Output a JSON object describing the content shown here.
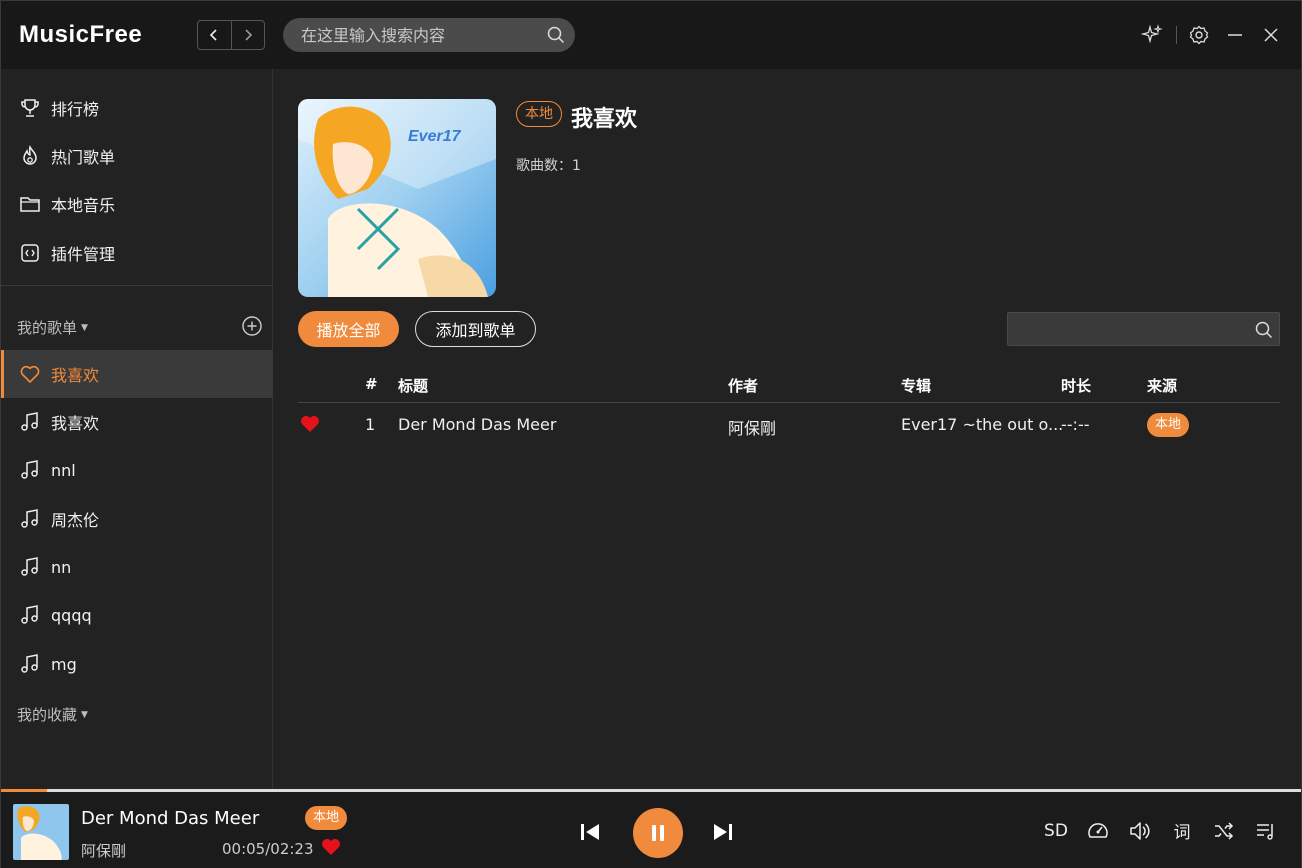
{
  "app": {
    "name": "MusicFree"
  },
  "search": {
    "placeholder": "在这里输入搜索内容"
  },
  "sidebar": {
    "nav": [
      {
        "label": "排行榜",
        "icon": "trophy-icon"
      },
      {
        "label": "热门歌单",
        "icon": "flame-icon"
      },
      {
        "label": "本地音乐",
        "icon": "folder-icon"
      },
      {
        "label": "插件管理",
        "icon": "plugin-icon"
      }
    ],
    "my_sheets_label": "我的歌单",
    "my_sheets": [
      {
        "label": "我喜欢",
        "icon": "heart-icon",
        "active": true
      },
      {
        "label": "我喜欢",
        "icon": "music-note-icon"
      },
      {
        "label": "nnl",
        "icon": "music-note-icon"
      },
      {
        "label": "周杰伦",
        "icon": "music-note-icon"
      },
      {
        "label": "nn",
        "icon": "music-note-icon"
      },
      {
        "label": "qqqq",
        "icon": "music-note-icon"
      },
      {
        "label": "mg",
        "icon": "music-note-icon"
      }
    ],
    "my_collections_label": "我的收藏"
  },
  "sheet": {
    "badge": "本地",
    "title": "我喜欢",
    "song_count_label": "歌曲数：1",
    "play_all": "播放全部",
    "add_to_sheet": "添加到歌单",
    "filter_placeholder": ""
  },
  "table": {
    "headers": {
      "index": "#",
      "title": "标题",
      "artist": "作者",
      "album": "专辑",
      "duration": "时长",
      "source": "来源"
    },
    "rows": [
      {
        "liked": true,
        "index": "1",
        "title": "Der Mond Das Meer",
        "artist": "阿保剛",
        "album": "Ever17 ~the out o...",
        "duration": "--:--",
        "source": "本地"
      }
    ]
  },
  "player": {
    "title": "Der Mond Das Meer",
    "badge": "本地",
    "artist": "阿保剛",
    "time": "00:05/02:23",
    "progress": 0.035,
    "quality": "SD",
    "lyric": "词"
  },
  "colors": {
    "accent": "#f08a3c",
    "heart": "#e5121b",
    "background": "#222222"
  }
}
